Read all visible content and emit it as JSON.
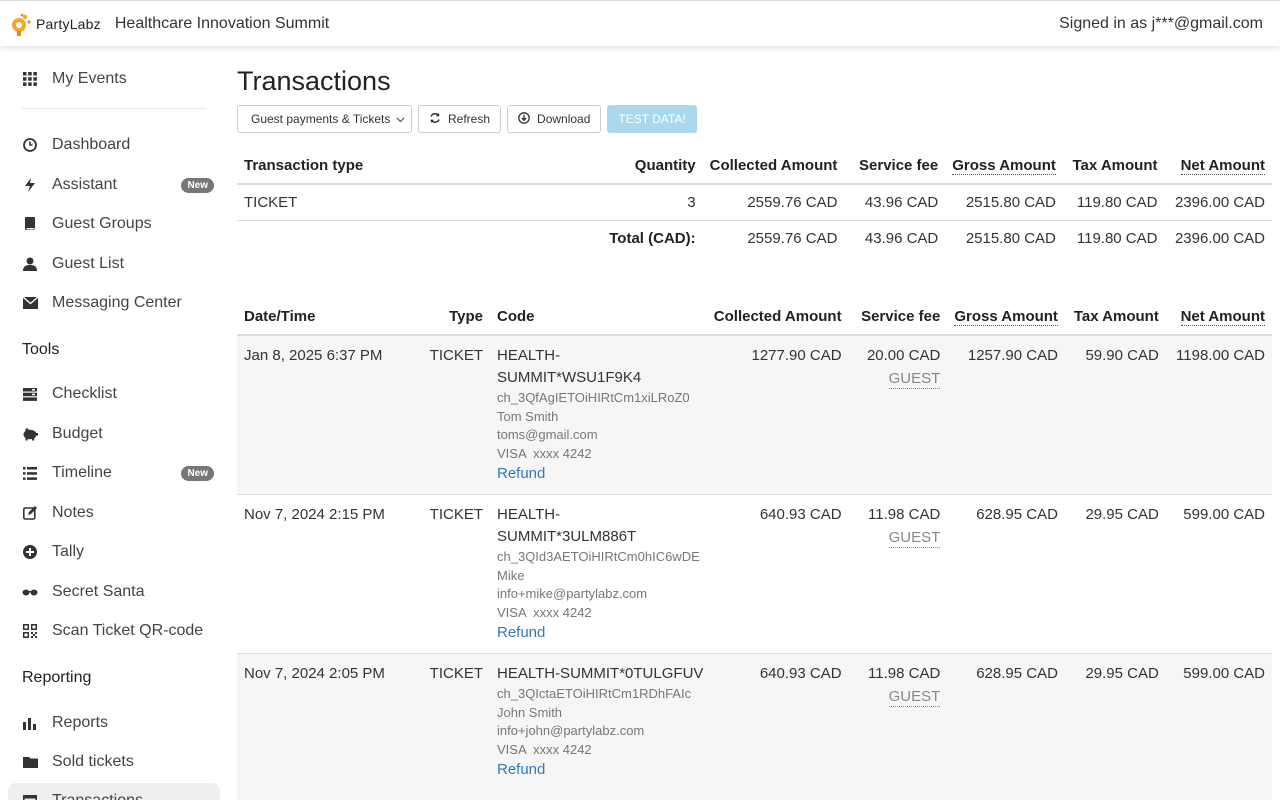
{
  "header": {
    "logo_text_1": "Party",
    "logo_text_2": "Labz",
    "event_title": "Healthcare Innovation Summit",
    "signed_in": "Signed in as j***@gmail.com"
  },
  "sidebar": {
    "my_events": "My Events",
    "items": [
      {
        "label": "Dashboard",
        "icon": "clock-icon"
      },
      {
        "label": "Assistant",
        "icon": "bolt-icon",
        "badge": "New"
      },
      {
        "label": "Guest Groups",
        "icon": "book-icon"
      },
      {
        "label": "Guest List",
        "icon": "user-icon"
      },
      {
        "label": "Messaging Center",
        "icon": "envelope-icon"
      }
    ],
    "tools_title": "Tools",
    "tools": [
      {
        "label": "Checklist",
        "icon": "list-icon"
      },
      {
        "label": "Budget",
        "icon": "piggy-bank-icon"
      },
      {
        "label": "Timeline",
        "icon": "timeline-icon",
        "badge": "New"
      },
      {
        "label": "Notes",
        "icon": "edit-icon"
      },
      {
        "label": "Tally",
        "icon": "plus-circle-icon"
      },
      {
        "label": "Secret Santa",
        "icon": "sunglasses-icon"
      },
      {
        "label": "Scan Ticket QR-code",
        "icon": "qrcode-icon"
      }
    ],
    "reporting_title": "Reporting",
    "reporting": [
      {
        "label": "Reports",
        "icon": "bar-chart-icon"
      },
      {
        "label": "Sold tickets",
        "icon": "folder-icon"
      },
      {
        "label": "Transactions",
        "icon": "table-icon"
      }
    ]
  },
  "main": {
    "title": "Transactions",
    "filter_value": "Guest payments & Tickets",
    "refresh_label": "Refresh",
    "download_label": "Download",
    "test_data_label": "TEST DATA!"
  },
  "summary": {
    "headers": [
      "Transaction type",
      "Quantity",
      "Collected Amount",
      "Service fee",
      "Gross Amount",
      "Tax Amount",
      "Net Amount"
    ],
    "row": {
      "type": "TICKET",
      "quantity": "3",
      "collected": "2559.76 CAD",
      "service": "43.96 CAD",
      "gross": "2515.80 CAD",
      "tax": "119.80 CAD",
      "net": "2396.00 CAD"
    },
    "total": {
      "label": "Total (CAD):",
      "collected": "2559.76 CAD",
      "service": "43.96 CAD",
      "gross": "2515.80 CAD",
      "tax": "119.80 CAD",
      "net": "2396.00 CAD"
    }
  },
  "transactions": {
    "headers": [
      "Date/Time",
      "Type",
      "Code",
      "Collected Amount",
      "Service fee",
      "Gross Amount",
      "Tax Amount",
      "Net Amount"
    ],
    "rows": [
      {
        "date": "Jan 8, 2025 6:37 PM",
        "type": "TICKET",
        "code": "HEALTH-SUMMIT*WSU1F9K4",
        "charge_id": "ch_3QfAgIETOiHIRtCm1xiLRoZ0",
        "name": "Tom Smith",
        "email": "toms@gmail.com",
        "card": "VISA  xxxx 4242",
        "refund": "Refund",
        "collected": "1277.90 CAD",
        "service": "20.00 CAD",
        "fee_payer": "GUEST",
        "gross": "1257.90 CAD",
        "tax": "59.90 CAD",
        "net": "1198.00 CAD"
      },
      {
        "date": "Nov 7, 2024 2:15 PM",
        "type": "TICKET",
        "code": "HEALTH-SUMMIT*3ULM886T",
        "charge_id": "ch_3QId3AETOiHIRtCm0hIC6wDE",
        "name": "Mike",
        "email": "info+mike@partylabz.com",
        "card": "VISA  xxxx 4242",
        "refund": "Refund",
        "collected": "640.93 CAD",
        "service": "11.98 CAD",
        "fee_payer": "GUEST",
        "gross": "628.95 CAD",
        "tax": "29.95 CAD",
        "net": "599.00 CAD"
      },
      {
        "date": "Nov 7, 2024 2:05 PM",
        "type": "TICKET",
        "code": "HEALTH-SUMMIT*0TULGFUV",
        "charge_id": "ch_3QIctaETOiHIRtCm1RDhFAIc",
        "name": "John Smith",
        "email": "info+john@partylabz.com",
        "card": "VISA  xxxx 4242",
        "refund": "Refund",
        "collected": "640.93 CAD",
        "service": "11.98 CAD",
        "fee_payer": "GUEST",
        "gross": "628.95 CAD",
        "tax": "29.95 CAD",
        "net": "599.00 CAD"
      }
    ]
  }
}
